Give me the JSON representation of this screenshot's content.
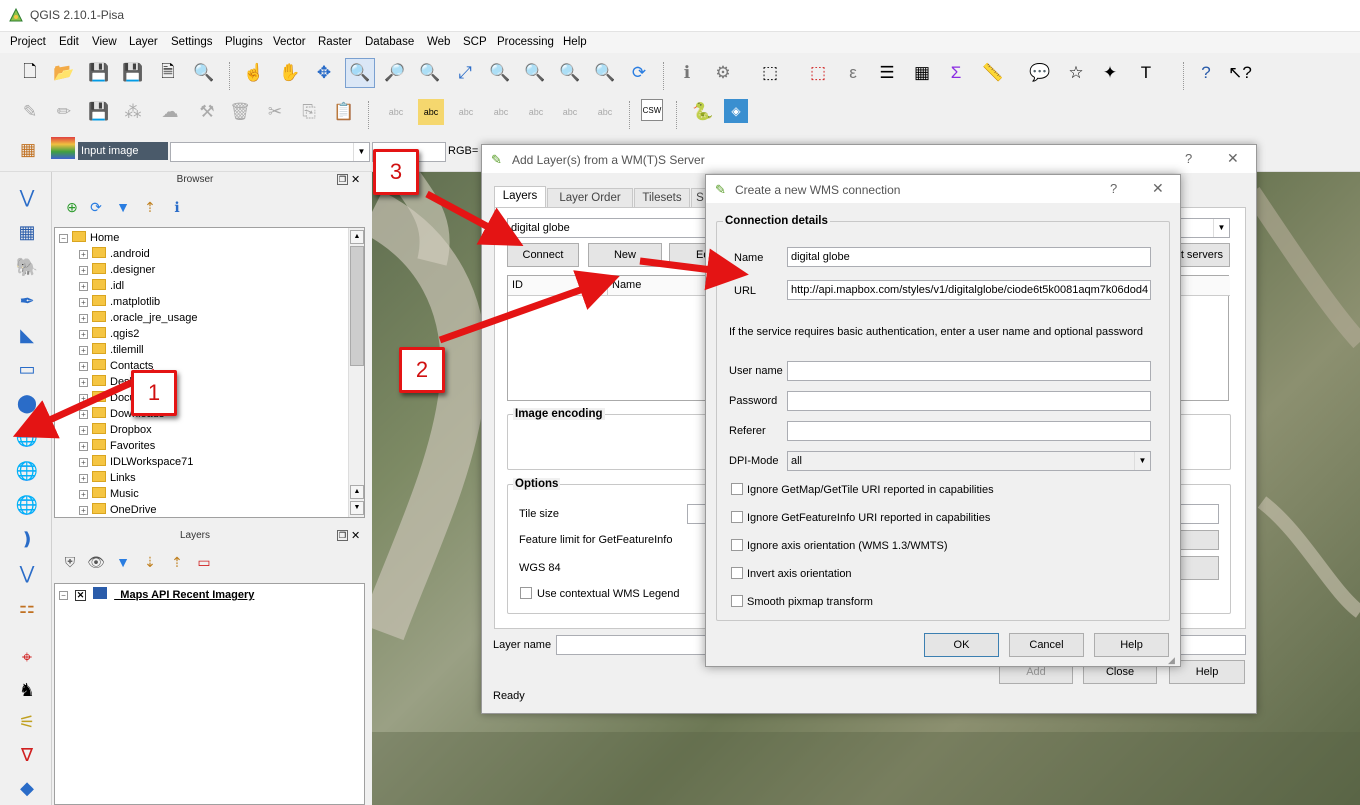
{
  "window": {
    "title": "QGIS 2.10.1-Pisa"
  },
  "menu": [
    "Project",
    "Edit",
    "View",
    "Layer",
    "Settings",
    "Plugins",
    "Vector",
    "Raster",
    "Database",
    "Web",
    "SCP",
    "Processing",
    "Help"
  ],
  "scp_toolbar": {
    "input_image_label": "Input image",
    "rgb_label": "RGB="
  },
  "browser": {
    "title": "Browser",
    "items": [
      "Home",
      ".android",
      ".designer",
      ".idl",
      ".matplotlib",
      ".oracle_jre_usage",
      ".qgis2",
      ".tilemill",
      "Contacts",
      "Desktop",
      "Documents",
      "Downloads",
      "Dropbox",
      "Favorites",
      "IDLWorkspace71",
      "Links",
      "Music",
      "OneDrive"
    ]
  },
  "layers_panel": {
    "title": "Layers",
    "layer_name": "_Maps API Recent Imagery"
  },
  "wms_dialog": {
    "title": "Add Layer(s) from a WM(T)S Server",
    "help_glyph": "?",
    "tabs": [
      "Layers",
      "Layer Order",
      "Tilesets",
      "S"
    ],
    "connection_value": "digital globe",
    "connect_label": "Connect",
    "new_label": "New",
    "edit_label": "Ed",
    "servers_label": "lt servers",
    "col_id": "ID",
    "col_name": "Name",
    "image_encoding_label": "Image encoding",
    "options_label": "Options",
    "tile_size_label": "Tile size",
    "feature_limit_label": "Feature limit for GetFeatureInfo",
    "wgs_label": "WGS 84",
    "legend_label": "Use contextual WMS Legend",
    "layer_name_label": "Layer name",
    "add_label": "Add",
    "close_label": "Close",
    "help_label": "Help",
    "status": "Ready"
  },
  "conn_dialog": {
    "title": "Create a new WMS connection",
    "help_glyph": "?",
    "group_label": "Connection details",
    "name_label": "Name",
    "name_value": "digital globe",
    "url_label": "URL",
    "url_value": "http://api.mapbox.com/styles/v1/digitalglobe/ciode6t5k0081aqm7k06dod4",
    "auth_note": "If the service requires basic authentication, enter a user name and optional password",
    "username_label": "User name",
    "password_label": "Password",
    "referer_label": "Referer",
    "dpi_label": "DPI-Mode",
    "dpi_value": "all",
    "checks": [
      "Ignore GetMap/GetTile URI reported in capabilities",
      "Ignore GetFeatureInfo URI reported in capabilities",
      "Ignore axis orientation (WMS 1.3/WMTS)",
      "Invert axis orientation",
      "Smooth pixmap transform"
    ],
    "ok_label": "OK",
    "cancel_label": "Cancel",
    "help_label": "Help"
  },
  "callouts": {
    "one": "1",
    "two": "2",
    "three": "3"
  },
  "colors": {
    "callout_red": "#e41414",
    "map_green": "#6d7855"
  }
}
